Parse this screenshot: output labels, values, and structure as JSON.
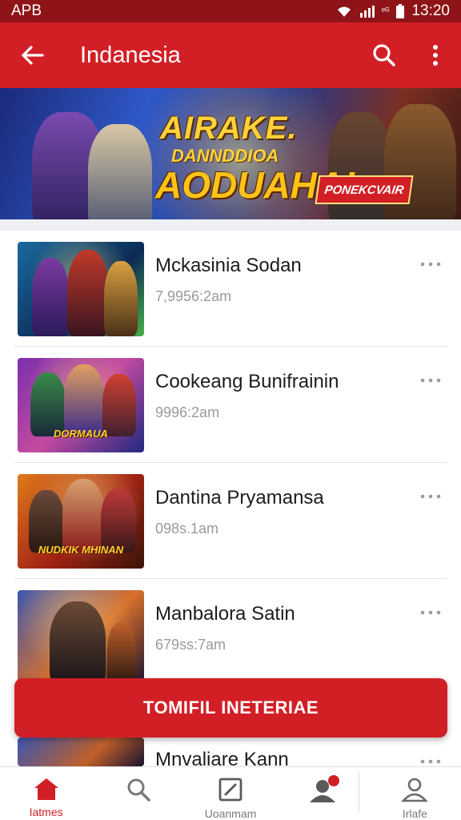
{
  "status_bar": {
    "left_label": "APB",
    "signal_text": "ᵉᴳ",
    "time": "13:20"
  },
  "app_bar": {
    "title": "Indanesia",
    "back_icon": "arrow-left-icon",
    "search_icon": "search-icon",
    "menu_icon": "more-vertical-icon"
  },
  "banner": {
    "line1": "AIRAKE.",
    "line2": "DANNDDIOA",
    "line3": "AODUAHA!",
    "cta": "PONEKCVAIR"
  },
  "items": [
    {
      "title": "Mckasinia Sodan",
      "meta": "7,9956:2am",
      "caption": "",
      "palette": [
        "#1a6aa0",
        "#0c2a55",
        "#48b04a"
      ]
    },
    {
      "title": "Cookeang Bunifrainin",
      "meta": "9996:2am",
      "caption": "DORMAUA",
      "palette": [
        "#7a2fb0",
        "#c44aa0",
        "#1f2a80"
      ]
    },
    {
      "title": "Dantina Pryamansa",
      "meta": "098s.1am",
      "caption": "NUDKIK MHINAN",
      "palette": [
        "#e07a1a",
        "#a02214",
        "#3a1408"
      ]
    },
    {
      "title": "Manbalora Satin",
      "meta": "679ss:7am",
      "caption": "",
      "palette": [
        "#3a56b0",
        "#d8702a",
        "#1a1430"
      ]
    }
  ],
  "peek_item": {
    "title": "Mnvaliare Kann"
  },
  "fab": {
    "label": "TOMIFIL INETERIAE"
  },
  "bottom_nav": [
    {
      "label": "Iatmes",
      "icon": "home-icon",
      "active": true
    },
    {
      "label": "",
      "icon": "search-icon",
      "active": false
    },
    {
      "label": "Uoanmam",
      "icon": "edit-icon",
      "active": false
    },
    {
      "label": "",
      "icon": "user-badge-icon",
      "active": false
    },
    {
      "label": "Irlafe",
      "icon": "profile-icon",
      "active": false
    }
  ],
  "colors": {
    "primary": "#d21f26",
    "status": "#8e1418",
    "text": "#1c1c1c",
    "meta": "#9a9a9a"
  }
}
